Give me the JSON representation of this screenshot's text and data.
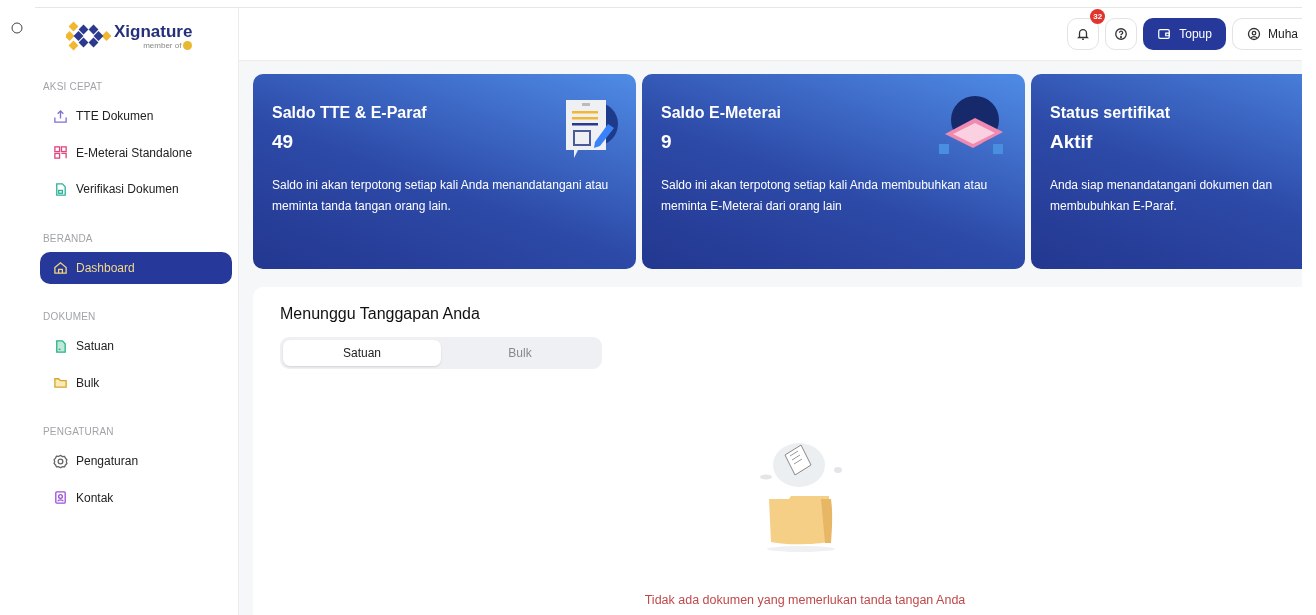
{
  "brand": {
    "name": "Xignature",
    "tagline": "member of"
  },
  "sidebar": {
    "sections": [
      {
        "title": "AKSI CEPAT",
        "items": [
          {
            "label": "TTE Dokumen",
            "selected": false
          },
          {
            "label": "E-Meterai Standalone",
            "selected": false
          },
          {
            "label": "Verifikasi Dokumen",
            "selected": false
          }
        ]
      },
      {
        "title": "BERANDA",
        "items": [
          {
            "label": "Dashboard",
            "selected": true
          }
        ]
      },
      {
        "title": "DOKUMEN",
        "items": [
          {
            "label": "Satuan",
            "selected": false
          },
          {
            "label": "Bulk",
            "selected": false
          }
        ]
      },
      {
        "title": "PENGATURAN",
        "items": [
          {
            "label": "Pengaturan",
            "selected": false
          },
          {
            "label": "Kontak",
            "selected": false
          }
        ]
      }
    ]
  },
  "header": {
    "notification_count": "32",
    "topup_label": "Topup",
    "user_label": "Muha"
  },
  "cards": [
    {
      "title": "Saldo TTE & E-Paraf",
      "value": "49",
      "description": "Saldo ini akan terpotong setiap kali Anda menandatangani atau meminta tanda tangan orang lain."
    },
    {
      "title": "Saldo E-Meterai",
      "value": "9",
      "description": "Saldo ini akan terpotong setiap kali Anda membubuhkan atau meminta E-Meterai dari orang lain"
    },
    {
      "title": "Status sertifikat",
      "value": "Aktif",
      "description": "Anda siap menandatangani dokumen dan membubuhkan E-Paraf."
    }
  ],
  "panel": {
    "title": "Menunggu Tanggapan Anda",
    "tabs": [
      {
        "label": "Satuan",
        "selected": true
      },
      {
        "label": "Bulk",
        "selected": false
      }
    ],
    "empty_message": "Tidak ada dokumen yang memerlukan tanda tangan Anda"
  }
}
